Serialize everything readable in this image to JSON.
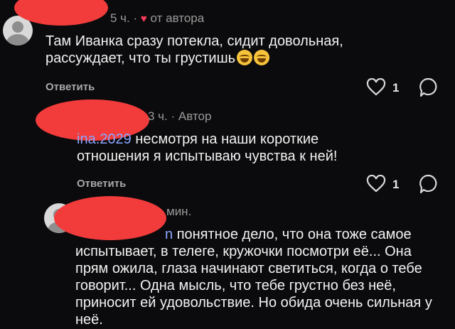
{
  "comments": [
    {
      "meta_time": "5 ч.",
      "meta_sep": "·",
      "meta_author_tag": "от автора",
      "text": "Там Иванка сразу потекла, сидит довольная, рассуждает, что ты грустишь",
      "reply_label": "Ответить",
      "like_count": "1"
    },
    {
      "meta_time": "3 ч.",
      "meta_sep": "·",
      "meta_author_tag": "Автор",
      "mention": "ina.2029",
      "text": "несмотря на наши короткие отношения я испытываю чувства к ней!",
      "reply_label": "Ответить",
      "like_count": "1"
    },
    {
      "meta_time": "мин.",
      "mention": "n",
      "text": "понятное дело, что она тоже самое испытывает, в телеге, кружочки посмотри её... Она прям ожила, глаза начинают светиться, когда о тебе говорит... Одна мысль, что тебе грустно без неё, приносит ей удовольствие. Но обида очень сильная у неё."
    }
  ],
  "icons": {
    "heart": "heart-icon",
    "comment": "comment-icon",
    "emoji": "laughing-emoji"
  },
  "colors": {
    "background": "#0b0b0d",
    "redaction": "#f23b3b",
    "mention": "#8aa6ff"
  }
}
